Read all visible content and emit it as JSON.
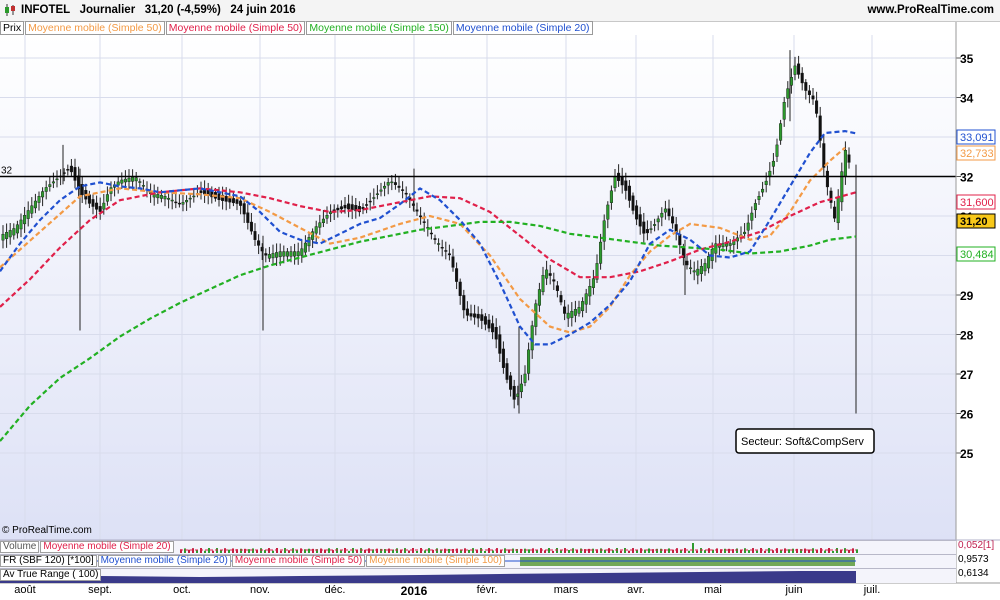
{
  "header": {
    "title": "INFOTEL   Journalier   31,20 (-4,59%)   24 juin 2016",
    "site": "www.ProRealTime.com"
  },
  "legend": [
    "Prix",
    "Moyenne mobile (Simple 50)",
    "Moyenne mobile (Simple 50)",
    "Moyenne mobile (Simple 150)",
    "Moyenne mobile (Simple 20)"
  ],
  "legend_colors": [
    "#000000",
    "#f39a45",
    "#e0204a",
    "#22b022",
    "#2050d0"
  ],
  "watermark": "© ProRealTime.com",
  "chart_data": {
    "type": "line",
    "ylim": [
      25,
      35.5
    ],
    "yticks": [
      "25",
      "26",
      "27",
      "28",
      "29",
      "30",
      "31",
      "32",
      "33",
      "34",
      "35"
    ],
    "xticks": [
      "août",
      "sept.",
      "oct.",
      "nov.",
      "déc.",
      "2016",
      "févr.",
      "mars",
      "avr.",
      "mai",
      "juin",
      "juil."
    ],
    "horizontal_line": {
      "label": "32",
      "value": 32
    },
    "price_label": "31,20",
    "value_labels": [
      {
        "text": "33,091",
        "color": "#2050d0"
      },
      {
        "text": "32,733",
        "color": "#f39a45"
      },
      {
        "text": "31,600",
        "color": "#e0204a"
      },
      {
        "text": "31,20",
        "color": "#000000"
      },
      {
        "text": "30,484",
        "color": "#22b022"
      }
    ],
    "annotation": "Secteur: Soft&CompServ",
    "series": [
      {
        "color": "#f39a45",
        "points": [
          [
            0,
            29.7
          ],
          [
            40,
            30.6
          ],
          [
            80,
            31.5
          ],
          [
            120,
            31.7
          ],
          [
            160,
            31.6
          ],
          [
            200,
            31.55
          ],
          [
            240,
            31.45
          ],
          [
            270,
            31.1
          ],
          [
            300,
            30.7
          ],
          [
            330,
            30.3
          ],
          [
            360,
            30.45
          ],
          [
            400,
            30.8
          ],
          [
            430,
            31.0
          ],
          [
            460,
            30.8
          ],
          [
            490,
            30.0
          ],
          [
            520,
            28.9
          ],
          [
            550,
            28.2
          ],
          [
            570,
            28.05
          ],
          [
            590,
            28.2
          ],
          [
            610,
            28.7
          ],
          [
            630,
            29.5
          ],
          [
            650,
            30.1
          ],
          [
            670,
            30.5
          ],
          [
            690,
            30.8
          ],
          [
            720,
            30.7
          ],
          [
            750,
            30.4
          ],
          [
            770,
            30.5
          ],
          [
            790,
            31.1
          ],
          [
            810,
            31.9
          ],
          [
            830,
            32.4
          ],
          [
            845,
            32.73
          ]
        ]
      },
      {
        "color": "#e0204a",
        "points": [
          [
            0,
            28.7
          ],
          [
            30,
            29.4
          ],
          [
            60,
            30.2
          ],
          [
            90,
            30.9
          ],
          [
            120,
            31.4
          ],
          [
            160,
            31.6
          ],
          [
            200,
            31.7
          ],
          [
            240,
            31.6
          ],
          [
            270,
            31.45
          ],
          [
            300,
            31.25
          ],
          [
            330,
            31.1
          ],
          [
            360,
            31.15
          ],
          [
            400,
            31.35
          ],
          [
            430,
            31.5
          ],
          [
            460,
            31.45
          ],
          [
            490,
            31.1
          ],
          [
            520,
            30.5
          ],
          [
            550,
            29.9
          ],
          [
            580,
            29.45
          ],
          [
            610,
            29.45
          ],
          [
            640,
            29.6
          ],
          [
            670,
            29.85
          ],
          [
            700,
            30.15
          ],
          [
            730,
            30.35
          ],
          [
            760,
            30.6
          ],
          [
            790,
            31.0
          ],
          [
            820,
            31.35
          ],
          [
            856,
            31.6
          ]
        ]
      },
      {
        "color": "#22b022",
        "points": [
          [
            0,
            25.3
          ],
          [
            30,
            26.2
          ],
          [
            60,
            26.9
          ],
          [
            90,
            27.4
          ],
          [
            120,
            27.95
          ],
          [
            150,
            28.4
          ],
          [
            180,
            28.8
          ],
          [
            210,
            29.15
          ],
          [
            240,
            29.5
          ],
          [
            270,
            29.75
          ],
          [
            300,
            29.95
          ],
          [
            330,
            30.15
          ],
          [
            360,
            30.35
          ],
          [
            390,
            30.5
          ],
          [
            420,
            30.65
          ],
          [
            450,
            30.75
          ],
          [
            480,
            30.85
          ],
          [
            510,
            30.85
          ],
          [
            540,
            30.75
          ],
          [
            570,
            30.55
          ],
          [
            600,
            30.45
          ],
          [
            630,
            30.35
          ],
          [
            660,
            30.25
          ],
          [
            690,
            30.2
          ],
          [
            720,
            30.15
          ],
          [
            750,
            30.05
          ],
          [
            780,
            30.1
          ],
          [
            810,
            30.25
          ],
          [
            830,
            30.4
          ],
          [
            856,
            30.48
          ]
        ]
      },
      {
        "color": "#2050d0",
        "points": [
          [
            0,
            29.6
          ],
          [
            20,
            30.3
          ],
          [
            40,
            30.9
          ],
          [
            60,
            31.4
          ],
          [
            80,
            31.75
          ],
          [
            100,
            31.85
          ],
          [
            120,
            31.75
          ],
          [
            140,
            31.7
          ],
          [
            160,
            31.6
          ],
          [
            180,
            31.65
          ],
          [
            200,
            31.7
          ],
          [
            220,
            31.6
          ],
          [
            240,
            31.5
          ],
          [
            260,
            31.1
          ],
          [
            280,
            30.6
          ],
          [
            300,
            30.4
          ],
          [
            320,
            30.3
          ],
          [
            340,
            30.55
          ],
          [
            360,
            30.8
          ],
          [
            380,
            30.95
          ],
          [
            400,
            31.3
          ],
          [
            420,
            31.7
          ],
          [
            440,
            31.4
          ],
          [
            460,
            30.9
          ],
          [
            480,
            30.3
          ],
          [
            500,
            29.3
          ],
          [
            520,
            28.2
          ],
          [
            535,
            27.75
          ],
          [
            550,
            27.75
          ],
          [
            570,
            28.0
          ],
          [
            590,
            28.3
          ],
          [
            610,
            28.75
          ],
          [
            630,
            29.35
          ],
          [
            650,
            30.3
          ],
          [
            670,
            30.65
          ],
          [
            690,
            30.4
          ],
          [
            710,
            30.0
          ],
          [
            730,
            29.95
          ],
          [
            750,
            30.1
          ],
          [
            770,
            30.9
          ],
          [
            790,
            31.75
          ],
          [
            810,
            32.6
          ],
          [
            825,
            33.1
          ],
          [
            845,
            33.15
          ],
          [
            856,
            33.09
          ]
        ]
      }
    ],
    "price_path": [
      [
        0,
        30.5
      ],
      [
        15,
        30.7
      ],
      [
        30,
        31.2
      ],
      [
        45,
        31.7
      ],
      [
        60,
        32.0
      ],
      [
        70,
        32.2
      ],
      [
        80,
        31.6
      ],
      [
        90,
        31.3
      ],
      [
        100,
        31.1
      ],
      [
        110,
        31.7
      ],
      [
        120,
        31.9
      ],
      [
        135,
        32.0
      ],
      [
        150,
        31.6
      ],
      [
        165,
        31.5
      ],
      [
        180,
        31.3
      ],
      [
        200,
        31.6
      ],
      [
        220,
        31.4
      ],
      [
        240,
        31.3
      ],
      [
        255,
        30.4
      ],
      [
        265,
        30.0
      ],
      [
        280,
        30.1
      ],
      [
        300,
        30.1
      ],
      [
        315,
        30.7
      ],
      [
        330,
        31.1
      ],
      [
        345,
        31.2
      ],
      [
        360,
        31.1
      ],
      [
        375,
        31.5
      ],
      [
        390,
        31.9
      ],
      [
        405,
        31.6
      ],
      [
        420,
        31.0
      ],
      [
        435,
        30.4
      ],
      [
        450,
        30.0
      ],
      [
        465,
        28.5
      ],
      [
        480,
        28.4
      ],
      [
        495,
        28.0
      ],
      [
        505,
        27.0
      ],
      [
        515,
        26.3
      ],
      [
        525,
        27.0
      ],
      [
        535,
        28.7
      ],
      [
        545,
        29.7
      ],
      [
        555,
        29.3
      ],
      [
        565,
        28.5
      ],
      [
        580,
        28.7
      ],
      [
        595,
        29.5
      ],
      [
        605,
        31.0
      ],
      [
        615,
        32.0
      ],
      [
        625,
        31.7
      ],
      [
        635,
        31.0
      ],
      [
        645,
        30.5
      ],
      [
        655,
        30.8
      ],
      [
        665,
        31.2
      ],
      [
        675,
        30.7
      ],
      [
        685,
        29.8
      ],
      [
        695,
        29.6
      ],
      [
        705,
        29.8
      ],
      [
        715,
        30.3
      ],
      [
        730,
        30.3
      ],
      [
        745,
        30.6
      ],
      [
        755,
        31.3
      ],
      [
        765,
        31.8
      ],
      [
        775,
        32.5
      ],
      [
        785,
        34.0
      ],
      [
        795,
        34.8
      ],
      [
        805,
        34.2
      ],
      [
        815,
        33.9
      ],
      [
        825,
        32.0
      ],
      [
        835,
        30.9
      ],
      [
        845,
        32.7
      ],
      [
        852,
        32.1
      ],
      [
        856,
        31.2
      ]
    ],
    "candles": [
      [
        63,
        32.8,
        31.8
      ],
      [
        80,
        32.2,
        28.1
      ],
      [
        263,
        30.5,
        28.1
      ],
      [
        414,
        32.2,
        31.1
      ],
      [
        519,
        28.2,
        26.0
      ],
      [
        685,
        30.4,
        29.0
      ],
      [
        790,
        35.2,
        33.4
      ],
      [
        856,
        32.3,
        26.0
      ]
    ],
    "indicators": [
      {
        "labels": [
          "Volume",
          "Moyenne mobile (Simple 20)"
        ],
        "value": "0,052[1]"
      },
      {
        "labels": [
          "FR (SBF 120) [*100]",
          "Moyenne mobile (Simple 20)",
          "Moyenne mobile (Simple 50)",
          "Moyenne mobile (Simple 100)"
        ],
        "value": "0,9573"
      },
      {
        "labels": [
          "Av True Range ( 100)"
        ],
        "value": "0,6134"
      }
    ]
  }
}
